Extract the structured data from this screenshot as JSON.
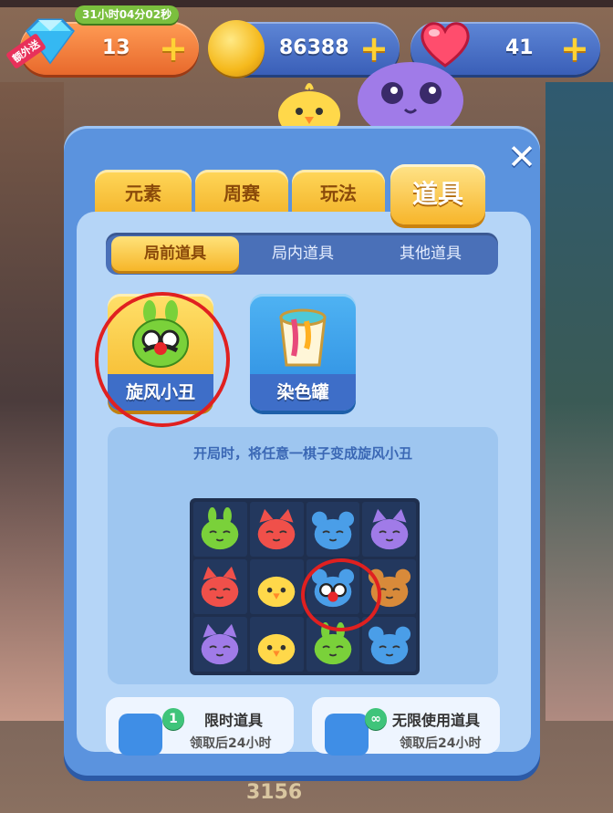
{
  "resources": {
    "gems": {
      "value": "13",
      "timer": "31小时04分02秒",
      "tag": "额外送"
    },
    "coins": {
      "value": "86388"
    },
    "lives": {
      "value": "41"
    },
    "plus_label": "+"
  },
  "dialog": {
    "close_label": "✕",
    "tabs": [
      {
        "label": "元素"
      },
      {
        "label": "周赛"
      },
      {
        "label": "玩法"
      },
      {
        "label": "道具"
      }
    ],
    "active_tab": "道具",
    "subtabs": [
      {
        "label": "局前道具"
      },
      {
        "label": "局内道具"
      },
      {
        "label": "其他道具"
      }
    ],
    "items": [
      {
        "label": "旋风小丑",
        "icon": "clown-bunny-icon"
      },
      {
        "label": "染色罐",
        "icon": "paint-bucket-icon"
      }
    ],
    "description": "开局时，将任意一棋子变成旋风小丑",
    "demo_grid": [
      [
        "green-bunny",
        "red-fox",
        "blue-mouse",
        "purple-cat"
      ],
      [
        "red-fox",
        "yellow-chick",
        "clown-piece",
        "brown-bear"
      ],
      [
        "purple-cat",
        "yellow-chick",
        "green-bunny",
        "blue-mouse"
      ]
    ],
    "cards": [
      {
        "badge": "1",
        "label": "限时道具",
        "sub": "领取后24小时"
      },
      {
        "badge": "∞",
        "label": "无限使用道具",
        "sub": "领取后24小时"
      }
    ]
  },
  "background": {
    "bottom_number": "3156"
  },
  "colors": {
    "panel": "#5b93de",
    "tab_gold": "#f3b42a",
    "highlight_ring": "#e02020"
  }
}
